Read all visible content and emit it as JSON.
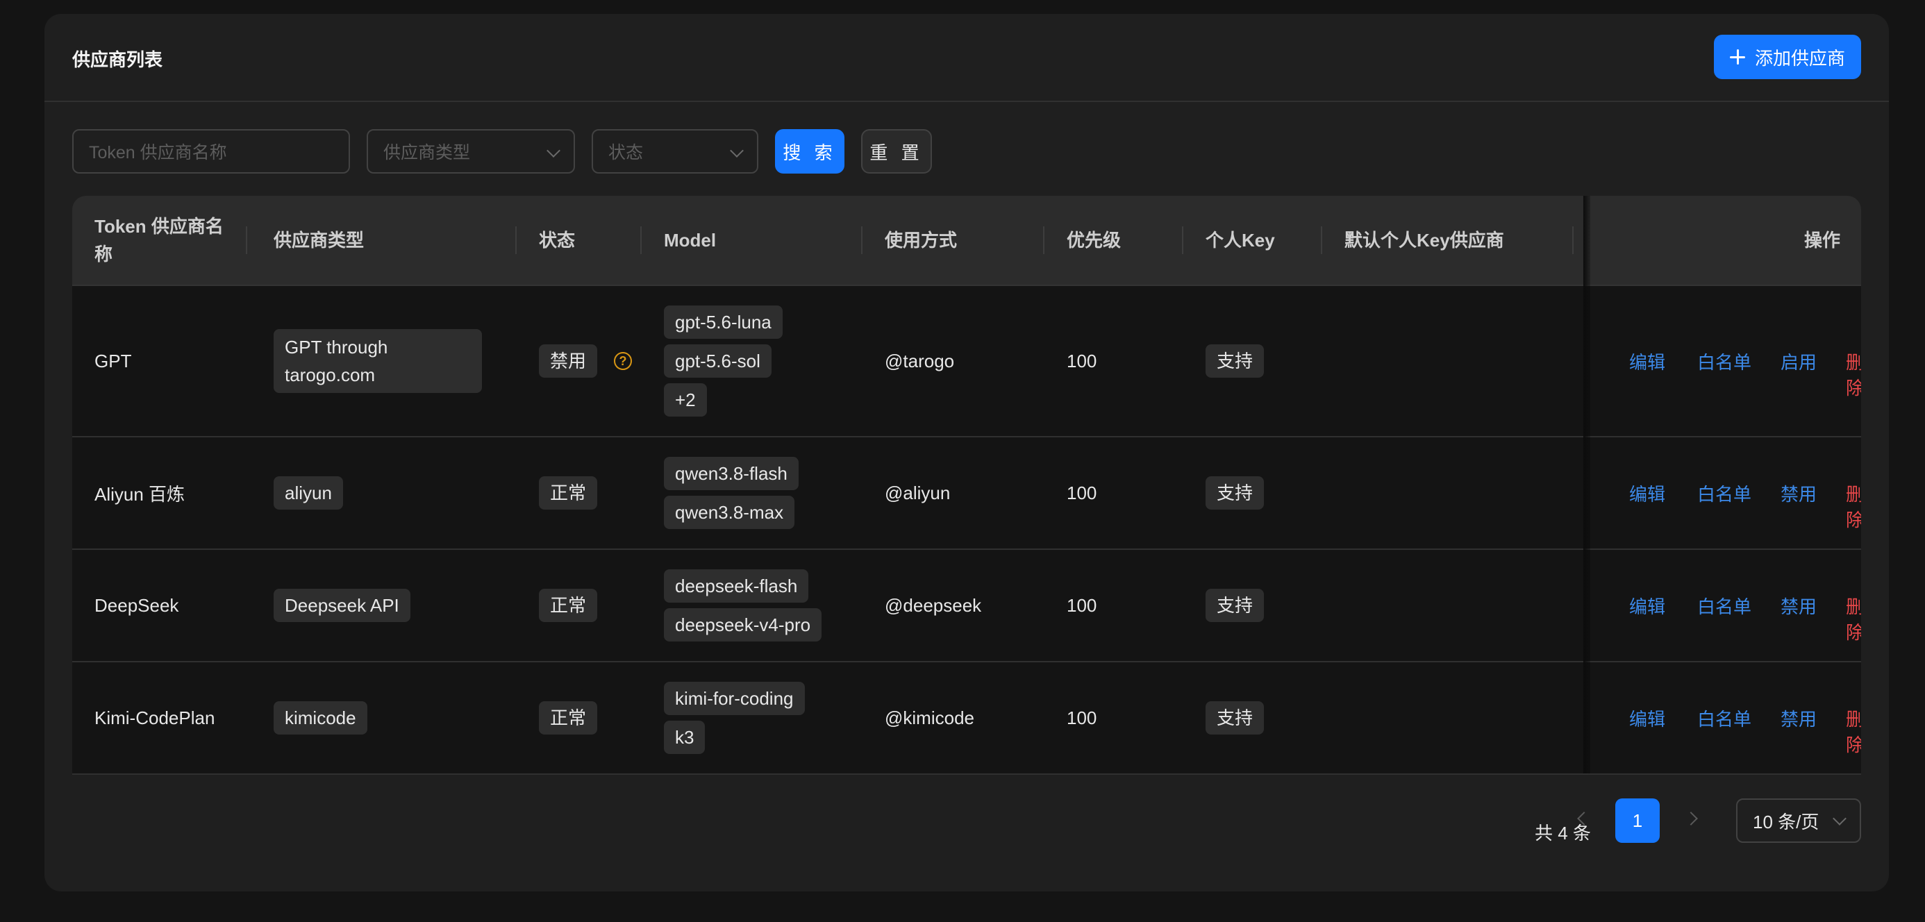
{
  "header": {
    "title": "供应商列表",
    "add_button_label": "添加供应商"
  },
  "filters": {
    "name_placeholder": "Token 供应商名称",
    "type_placeholder": "供应商类型",
    "status_placeholder": "状态",
    "search_label": "搜 索",
    "reset_label": "重 置"
  },
  "table": {
    "columns": [
      "Token 供应商名\n称",
      "供应商类型",
      "状态",
      "Model",
      "使用方式",
      "优先级",
      "个人Key",
      "默认个人Key供应商",
      "操作"
    ],
    "rows": [
      {
        "name": "GPT",
        "type": "GPT through\ntarogo.com",
        "status": "禁用",
        "models": [
          "gpt-5.6-luna",
          "gpt-5.6-sol",
          "+2"
        ],
        "usage": "@tarogo",
        "priority": "100",
        "personal_key": "支持",
        "actions": {
          "edit": "编辑",
          "whitelist": "白名单",
          "toggle": "启用",
          "delete": "删除"
        }
      },
      {
        "name": "Aliyun 百炼",
        "type": "aliyun",
        "status": "正常",
        "models": [
          "qwen3.8-flash",
          "qwen3.8-max"
        ],
        "usage": "@aliyun",
        "priority": "100",
        "personal_key": "支持",
        "actions": {
          "edit": "编辑",
          "whitelist": "白名单",
          "toggle": "禁用",
          "delete": "删除"
        }
      },
      {
        "name": "DeepSeek",
        "type": "Deepseek API",
        "status": "正常",
        "models": [
          "deepseek-flash",
          "deepseek-v4-pro"
        ],
        "usage": "@deepseek",
        "priority": "100",
        "personal_key": "支持",
        "actions": {
          "edit": "编辑",
          "whitelist": "白名单",
          "toggle": "禁用",
          "delete": "删除"
        }
      },
      {
        "name": "Kimi-CodePlan",
        "type": "kimicode",
        "status": "正常",
        "models": [
          "kimi-for-coding",
          "k3"
        ],
        "usage": "@kimicode",
        "priority": "100",
        "personal_key": "支持",
        "actions": {
          "edit": "编辑",
          "whitelist": "白名单",
          "toggle": "禁用",
          "delete": "删除"
        }
      }
    ]
  },
  "pagination": {
    "total": "共 4 条",
    "current_page": "1",
    "page_size": "10 条/页"
  },
  "colors": {
    "primary": "#1677ff",
    "link": "#3c89e8",
    "danger": "#e84749",
    "warning": "#d89614"
  }
}
